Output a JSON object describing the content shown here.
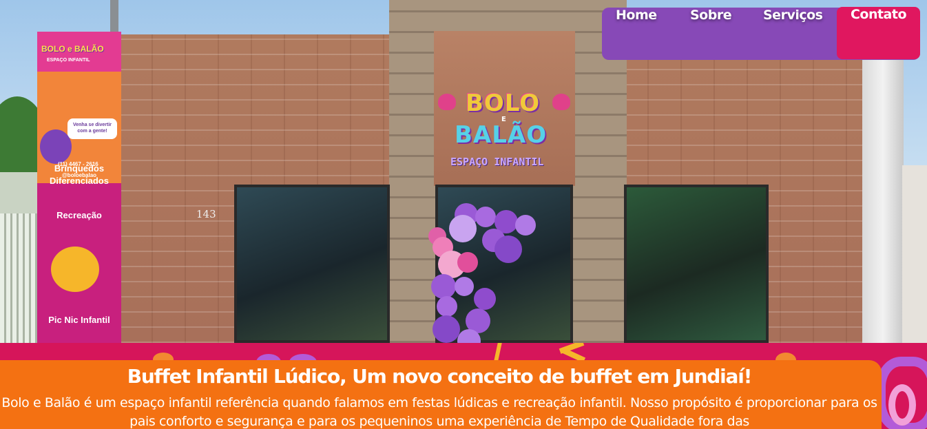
{
  "nav": {
    "items": [
      {
        "label": "Home"
      },
      {
        "label": "Sobre"
      },
      {
        "label": "Serviços"
      }
    ],
    "cta_label": "Contato"
  },
  "hero": {
    "house_number": "143",
    "sign": {
      "line1": "BOLO",
      "connector": "E",
      "line2": "BALÃO",
      "subtitle": "ESPAÇO INFANTIL"
    },
    "totem": {
      "brand": "BOLO e BALÃO",
      "brand_sub": "ESPAÇO INFANTIL",
      "bubble": "Venha se divertir com a gente!",
      "phone": "(11) 4467 - 2616",
      "instagram": "@boloebalao",
      "feature1": "Brinquedos Diferenciados",
      "feature2": "Recreação",
      "feature3": "Pic Nic Infantil"
    }
  },
  "intro": {
    "title": "Buffet Infantil Lúdico, Um novo conceito de buffet em Jundiaí!",
    "body": "Bolo e Balão é um espaço infantil referência quando falamos em festas lúdicas e recreação infantil. Nosso propósito é proporcionar para os pais conforto e segurança e para os pequeninos uma experiência de Tempo de Qualidade fora das"
  },
  "colors": {
    "nav_bg": "#8749b7",
    "cta_bg": "#e0175f",
    "band_bg": "#d6155a",
    "card_bg": "#f47112"
  }
}
